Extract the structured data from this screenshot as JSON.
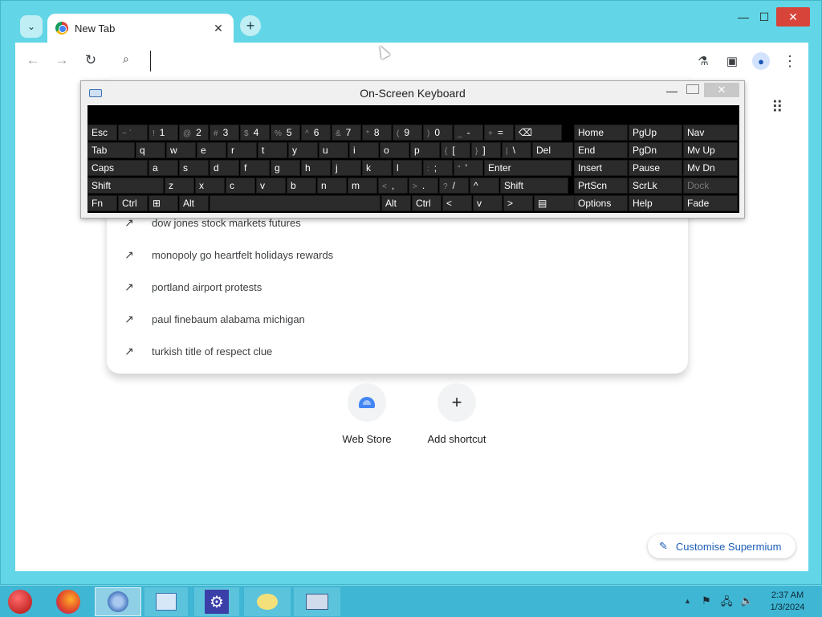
{
  "browser": {
    "tab_title": "New Tab",
    "tab_close": "✕",
    "new_tab": "+",
    "win_min": "—",
    "win_max": "☐",
    "win_close": "✕"
  },
  "toolbar": {
    "back": "←",
    "forward": "→",
    "reload": "↻",
    "search_icon": "🔍",
    "omnibox_value": "",
    "labs": "⚗",
    "sidepanel": "▣",
    "profile": "👤",
    "menu": "⋮"
  },
  "suggestions": [
    "dow jones stock markets futures",
    "monopoly go heartfelt holidays rewards",
    "portland airport protests",
    "paul finebaum alabama michigan",
    "turkish title of respect clue"
  ],
  "trend_icon": "↗",
  "shortcuts": [
    {
      "label": "Web Store"
    },
    {
      "label": "Add shortcut",
      "symbol": "+"
    }
  ],
  "customise": {
    "label": "Customise Supermium",
    "icon": "✎"
  },
  "apps_icon": "⋮⋮⋮",
  "osk": {
    "title": "On-Screen Keyboard",
    "min": "—",
    "close": "✕",
    "row1": [
      {
        "label": "Esc"
      },
      {
        "sec": "~ `",
        "label": ""
      },
      {
        "sec": "!",
        "label": "1"
      },
      {
        "sec": "@",
        "label": "2"
      },
      {
        "sec": "#",
        "label": "3"
      },
      {
        "sec": "$",
        "label": "4"
      },
      {
        "sec": "%",
        "label": "5"
      },
      {
        "sec": "^",
        "label": "6"
      },
      {
        "sec": "&",
        "label": "7"
      },
      {
        "sec": "*",
        "label": "8"
      },
      {
        "sec": "(",
        "label": "9"
      },
      {
        "sec": ")",
        "label": "0"
      },
      {
        "sec": "_",
        "label": "-"
      },
      {
        "sec": "+",
        "label": "="
      },
      {
        "label": "⌫"
      }
    ],
    "row2": [
      {
        "label": "Tab"
      },
      {
        "label": "q"
      },
      {
        "label": "w"
      },
      {
        "label": "e"
      },
      {
        "label": "r"
      },
      {
        "label": "t"
      },
      {
        "label": "y"
      },
      {
        "label": "u"
      },
      {
        "label": "i"
      },
      {
        "label": "o"
      },
      {
        "label": "p"
      },
      {
        "sec": "{",
        "label": "["
      },
      {
        "sec": "}",
        "label": "]"
      },
      {
        "sec": "|",
        "label": "\\"
      },
      {
        "label": "Del"
      }
    ],
    "row3": [
      {
        "label": "Caps"
      },
      {
        "label": "a"
      },
      {
        "label": "s"
      },
      {
        "label": "d"
      },
      {
        "label": "f"
      },
      {
        "label": "g"
      },
      {
        "label": "h"
      },
      {
        "label": "j"
      },
      {
        "label": "k"
      },
      {
        "label": "l"
      },
      {
        "sec": ":",
        "label": ";"
      },
      {
        "sec": "\"",
        "label": "'"
      },
      {
        "label": "Enter"
      }
    ],
    "row4": [
      {
        "label": "Shift"
      },
      {
        "label": "z"
      },
      {
        "label": "x"
      },
      {
        "label": "c"
      },
      {
        "label": "v"
      },
      {
        "label": "b"
      },
      {
        "label": "n"
      },
      {
        "label": "m"
      },
      {
        "sec": "<",
        "label": ","
      },
      {
        "sec": ">",
        "label": "."
      },
      {
        "sec": "?",
        "label": "/"
      },
      {
        "label": "^"
      },
      {
        "label": "Shift"
      }
    ],
    "row5": [
      {
        "label": "Fn"
      },
      {
        "label": "Ctrl"
      },
      {
        "label": "⊞"
      },
      {
        "label": "Alt"
      },
      {
        "label": ""
      },
      {
        "label": "Alt"
      },
      {
        "label": "Ctrl"
      },
      {
        "label": "<"
      },
      {
        "label": "v"
      },
      {
        "label": ">"
      },
      {
        "label": "▤"
      }
    ],
    "side": [
      [
        "Home",
        "PgUp",
        "Nav"
      ],
      [
        "End",
        "PgDn",
        "Mv Up"
      ],
      [
        "Insert",
        "Pause",
        "Mv Dn"
      ],
      [
        "PrtScn",
        "ScrLk",
        "Dock"
      ],
      [
        "Options",
        "Help",
        "Fade"
      ]
    ]
  },
  "taskbar": {
    "time": "2:37 AM",
    "date": "1/3/2024",
    "tray_up": "▲"
  }
}
